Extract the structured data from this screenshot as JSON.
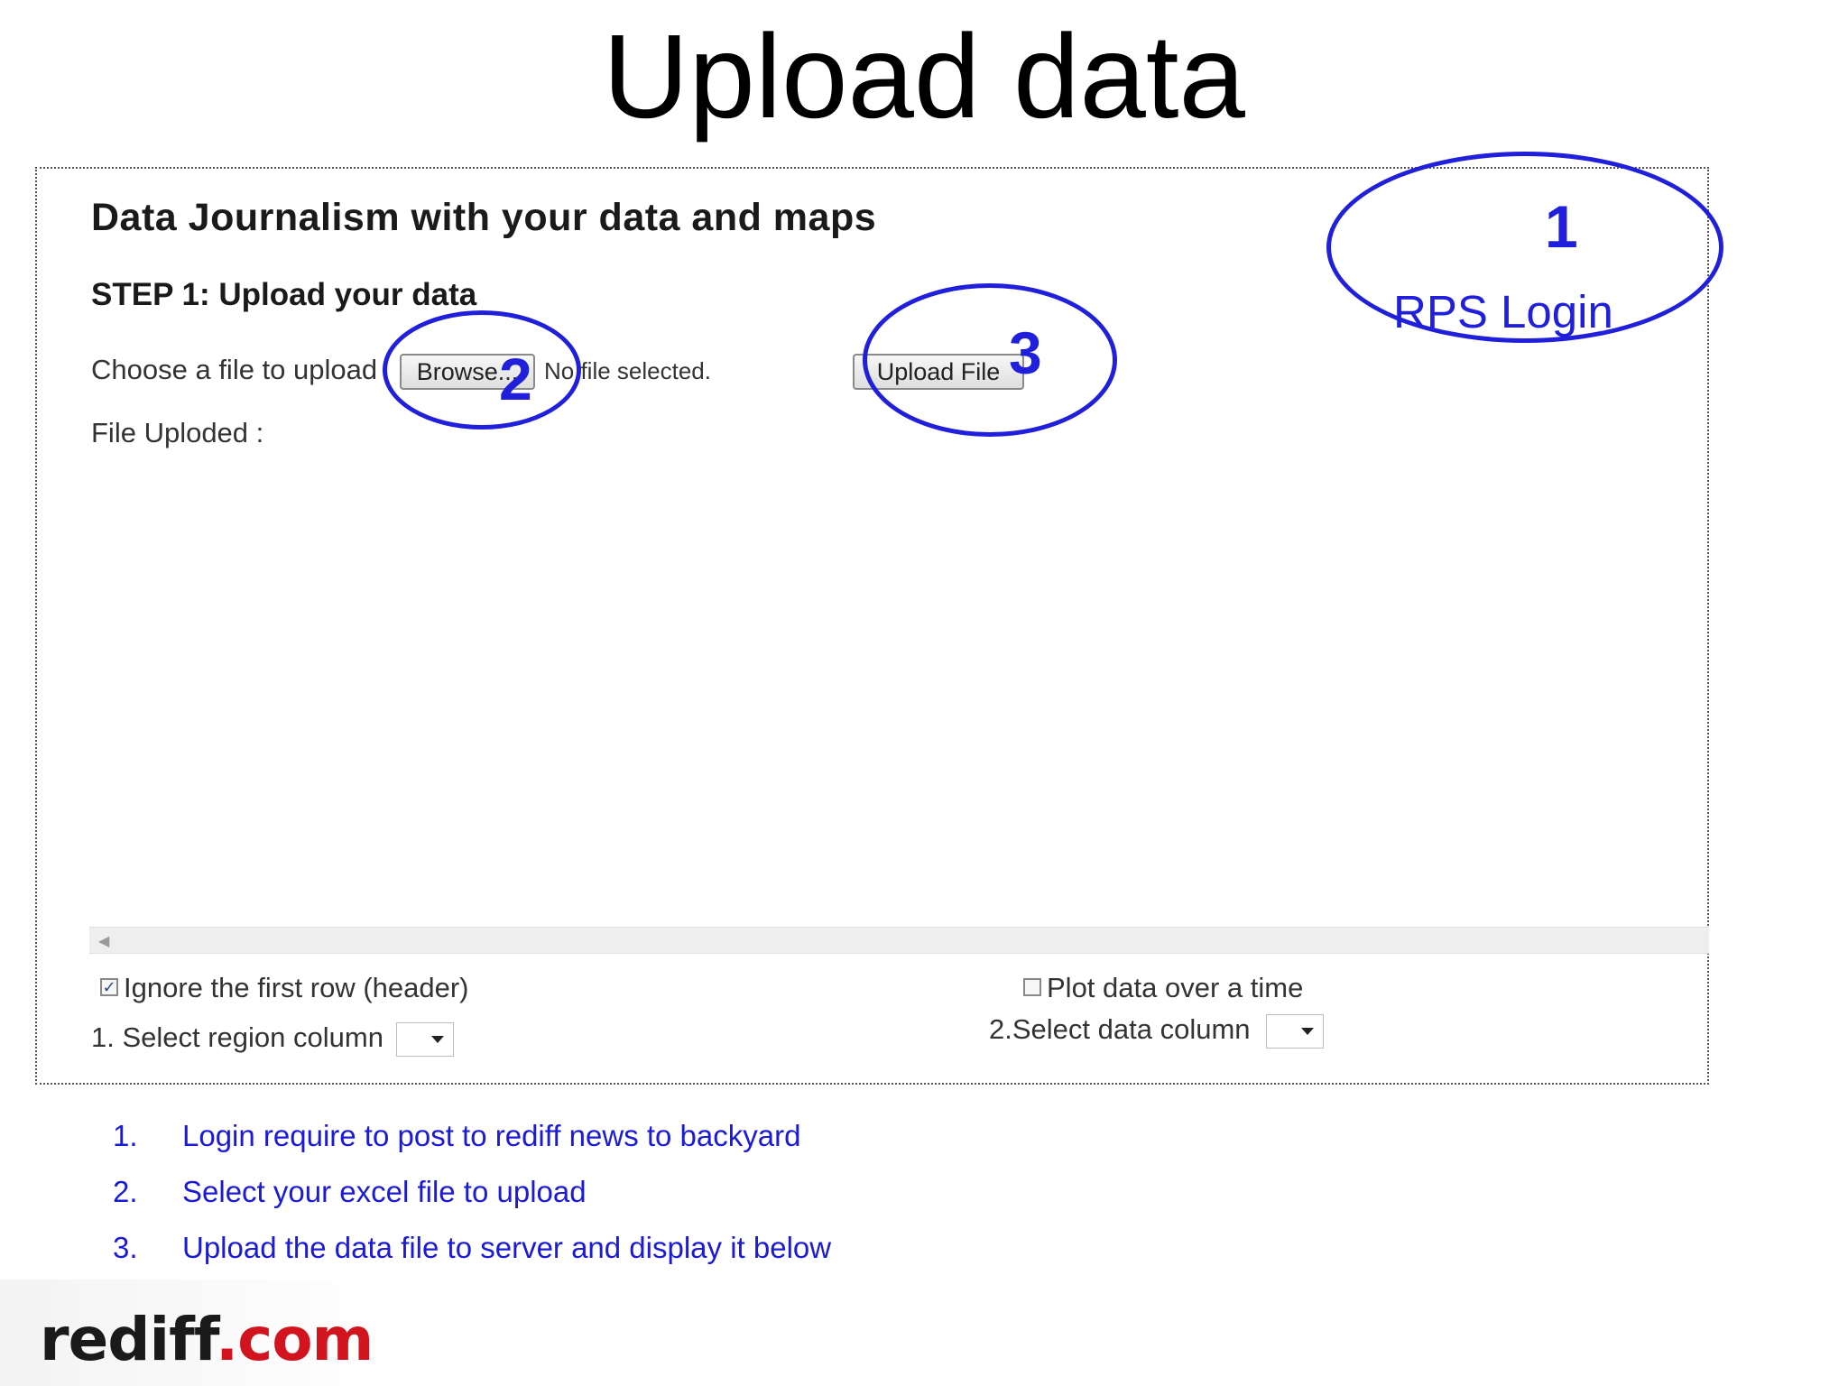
{
  "slide": {
    "title": "Upload data"
  },
  "app": {
    "heading": "Data Journalism with your data and maps",
    "step_heading": "STEP 1: Upload your data",
    "choose_label": "Choose a file to upload",
    "browse_label": "Browse...",
    "no_file_text": "No file selected.",
    "upload_button_label": "Upload File",
    "file_uploaded_label": "File Uploded :",
    "ignore_header_label": "Ignore the first row (header)",
    "ignore_header_checked": true,
    "plot_over_time_label": "Plot data over a time",
    "plot_over_time_checked": false,
    "region_column_label": "1. Select region column",
    "region_column_value": "",
    "data_column_label": "2.Select data column",
    "data_column_value": ""
  },
  "annotations": {
    "marker_1": "1",
    "marker_2": "2",
    "marker_3": "3",
    "login_text": "RPS Login",
    "color": "#1f1fdc"
  },
  "notes": [
    {
      "num": "1.",
      "text": "Login require to post to rediff news to backyard"
    },
    {
      "num": "2.",
      "text": "Select your excel file to upload"
    },
    {
      "num": "3.",
      "text": "Upload the data file to server and display it below"
    }
  ],
  "logo": {
    "part1": "rediff",
    "part2": ".com",
    "brand_red": "#d2141e"
  }
}
